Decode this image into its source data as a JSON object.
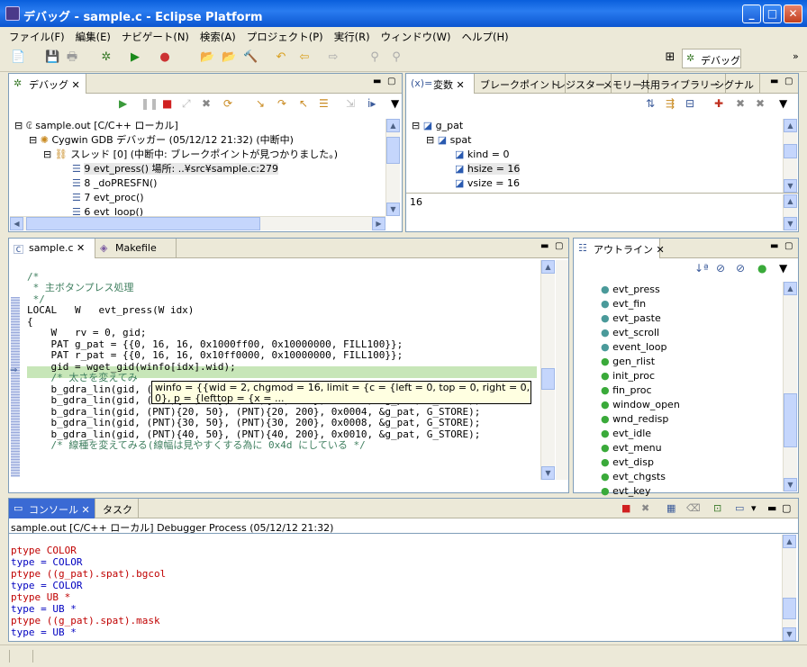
{
  "window": {
    "title": "デバッグ - sample.c - Eclipse Platform",
    "min": "_",
    "max": "□",
    "close": "✕"
  },
  "menu": [
    "ファイル(F)",
    "編集(E)",
    "ナビゲート(N)",
    "検索(A)",
    "プロジェクト(P)",
    "実行(R)",
    "ウィンドウ(W)",
    "ヘルプ(H)"
  ],
  "perspective": {
    "label": "デバッグ",
    "more": "»"
  },
  "debug_view": {
    "tab": "デバッグ",
    "items": [
      "sample.out [C/C++ ローカル]",
      "Cygwin GDB デバッガー (05/12/12 21:32) (中断中)",
      "スレッド [0] (中断中: ブレークポイントが見つかりました。)",
      "9 evt_press() 場所: ..¥src¥sample.c:279",
      "8 _doPRESFN()",
      "7 evt_proc()",
      "6 evt_loop()"
    ]
  },
  "variables_view": {
    "tabs": [
      "変数",
      "ブレークポイント",
      "レジスター",
      "メモリー",
      "共用ライブラリー",
      "シグナル"
    ],
    "items": [
      "g_pat",
      "spat",
      "kind = 0",
      "hsize = 16",
      "vsize = 16"
    ],
    "detail": "16"
  },
  "editor": {
    "tabs": [
      "sample.c",
      "Makefile"
    ],
    "lines": [
      "/*",
      " * 主ボタンプレス処理",
      " */",
      "LOCAL   W   evt_press(W idx)",
      "{",
      "    W   rv = 0, gid;",
      "    PAT g_pat = {{0, 16, 16, 0x1000ff00, 0x10000000, FILL100}};",
      "    PAT r_pat = {{0, 16, 16, 0x10ff0000, 0x10000000, FILL100}};",
      "",
      "    gid = wget_gid(winfo[idx].wid);",
      "",
      "    /* 太さを変えてみ",
      "    b_gdra_lin(gid, (PNT){0, 50}, (PNT){0, 200}, 0x0001, &g_pat, G_STORE);",
      "    b_gdra_lin(gid, (PNT){10, 50}, (PNT){10, 200}, 0x0002, &g_pat, G_STORE);",
      "    b_gdra_lin(gid, (PNT){20, 50}, (PNT){20, 200}, 0x0004, &g_pat, G_STORE);",
      "    b_gdra_lin(gid, (PNT){30, 50}, (PNT){30, 200}, 0x0008, &g_pat, G_STORE);",
      "    b_gdra_lin(gid, (PNT){40, 50}, (PNT){40, 200}, 0x0010, &g_pat, G_STORE);",
      "",
      "    /* 線種を変えてみる(線幅は見やすくする為に 0x4d にしている */"
    ],
    "tooltip": [
      "winfo = {{wid = 2, chgmod = 16, limit = {c = {left = 0, top = 0, right = 0,",
      "0}, p = {lefttop = {x = ..."
    ]
  },
  "outline_view": {
    "tab": "アウトライン",
    "items": [
      "evt_press",
      "evt_fin",
      "evt_paste",
      "evt_scroll",
      "event_loop",
      "gen_rlist",
      "init_proc",
      "fin_proc",
      "window_open",
      "wnd_redisp",
      "evt_idle",
      "evt_menu",
      "evt_disp",
      "evt_chgsts",
      "evt_key"
    ]
  },
  "console_view": {
    "tabs": [
      "コンソール",
      "タスク"
    ],
    "header": "sample.out [C/C++ ローカル] Debugger Process (05/12/12 21:32)",
    "lines": [
      {
        "t": "ptype COLOR",
        "c": "red"
      },
      {
        "t": "type = COLOR",
        "c": "blue"
      },
      {
        "t": "ptype ((g_pat).spat).bgcol",
        "c": "red"
      },
      {
        "t": "type = COLOR",
        "c": "blue"
      },
      {
        "t": "ptype UB *",
        "c": "red"
      },
      {
        "t": "type = UB *",
        "c": "blue"
      },
      {
        "t": "ptype ((g_pat).spat).mask",
        "c": "red"
      },
      {
        "t": "type = UB *",
        "c": "blue"
      }
    ]
  }
}
